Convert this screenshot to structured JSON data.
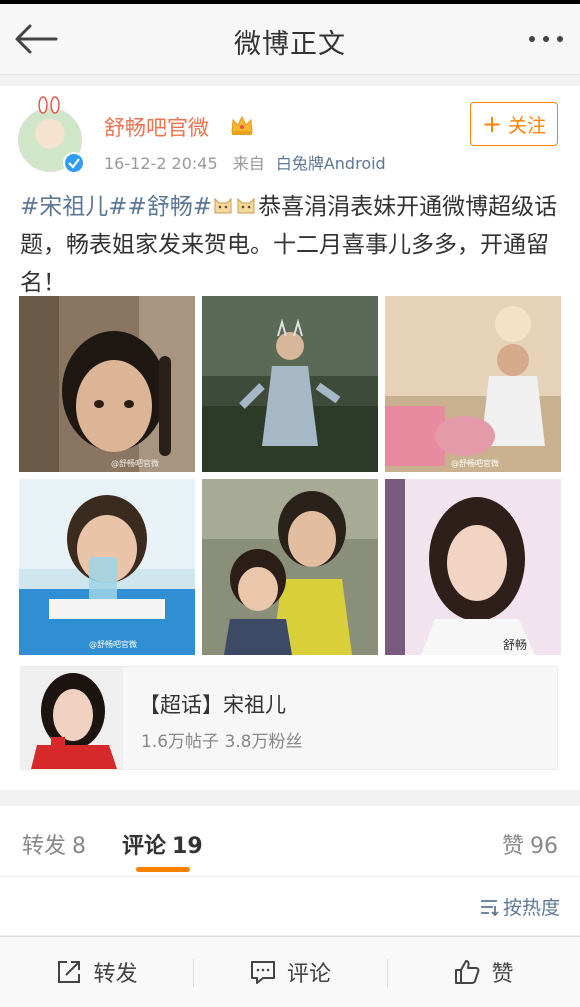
{
  "nav": {
    "title": "微博正文",
    "back_icon": "back-arrow-icon",
    "more_icon": "more-dots-icon"
  },
  "post": {
    "author": "舒畅吧官微",
    "badge_icon": "crown-icon",
    "time": "16-12-2 20:45",
    "from_label": "来自",
    "source": "白兔牌Android",
    "follow_label": "关注",
    "text": {
      "topic1": "#宋祖儿#",
      "topic2": "#舒畅#",
      "body": "恭喜涓涓表妹开通微博超级话题，畅表姐家发来贺电。十二月喜事儿多多，开通留名！"
    },
    "photos": [
      {
        "watermark": "@舒畅吧官微"
      },
      {
        "watermark": ""
      },
      {
        "watermark": "@舒畅吧官微"
      },
      {
        "watermark": "@舒畅吧官微"
      },
      {
        "watermark": ""
      },
      {
        "watermark": "舒畅"
      }
    ]
  },
  "super_topic": {
    "title": "【超话】宋祖儿",
    "stats": "1.6万帖子 3.8万粉丝"
  },
  "tabs": {
    "repost_label": "转发",
    "repost_count": "8",
    "comment_label": "评论",
    "comment_count": "19",
    "like_label": "赞",
    "like_count": "96"
  },
  "sort": {
    "label": "按热度"
  },
  "actions": {
    "repost": "转发",
    "comment": "评论",
    "like": "赞"
  },
  "colors": {
    "accent": "#ff8200",
    "username": "#eb7350",
    "link": "#5d7895"
  }
}
